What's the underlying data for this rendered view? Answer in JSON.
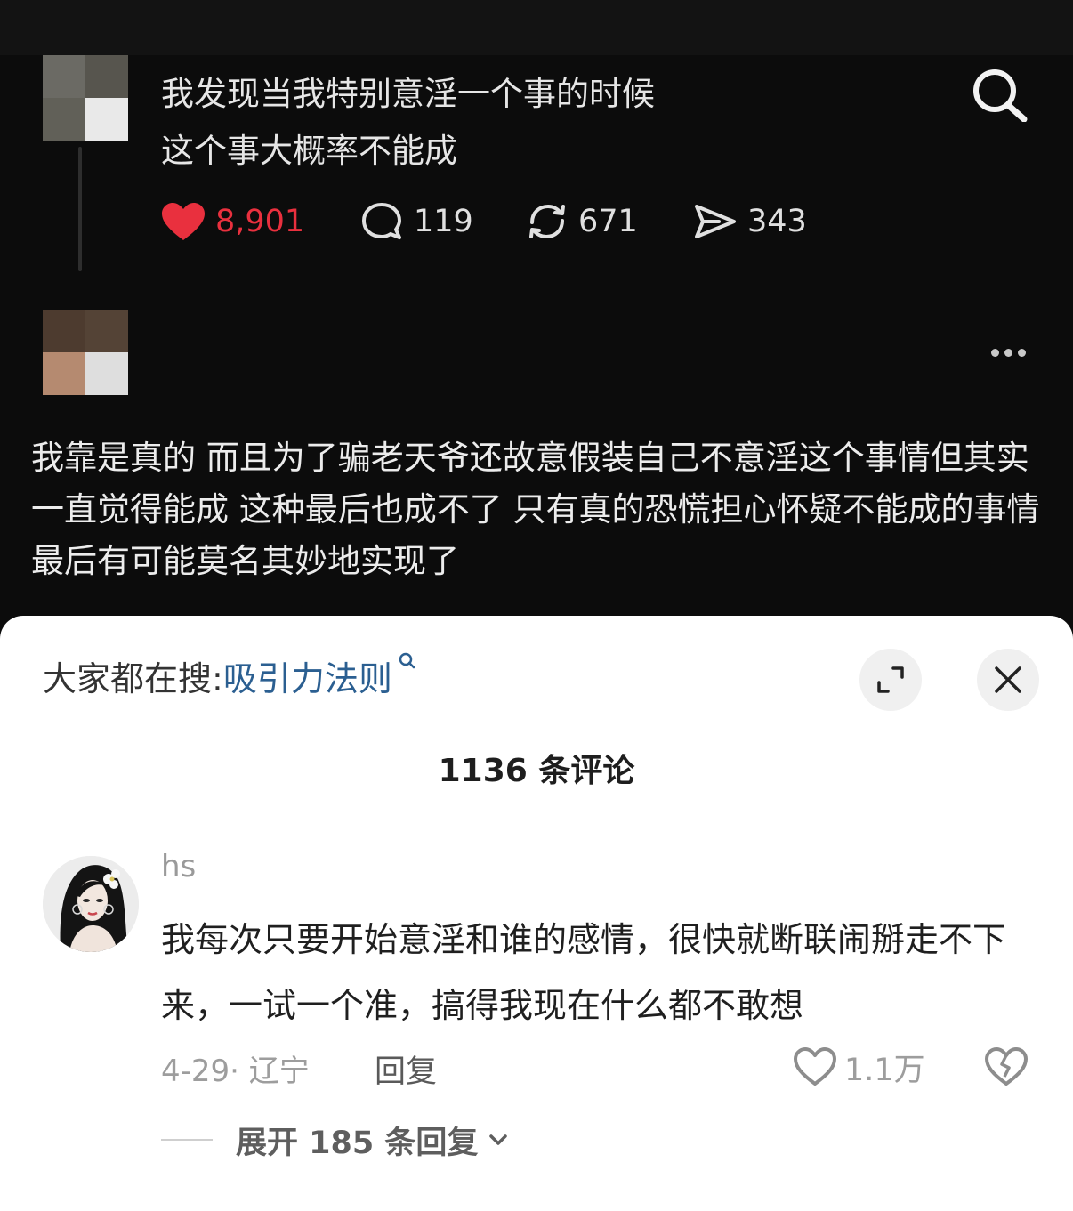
{
  "post": {
    "text_line1": "我发现当我特别意淫一个事的时候",
    "text_line2": "这个事大概率不能成",
    "likes": "8,901",
    "comments": "119",
    "reposts": "671",
    "shares": "343"
  },
  "reply_post": {
    "text": "我靠是真的 而且为了骗老天爷还故意假装自己不意淫这个事情但其实一直觉得能成 这种最后也成不了 只有真的恐慌担心怀疑不能成的事情最后有可能莫名其妙地实现了"
  },
  "comments_sheet": {
    "search_prefix": "大家都在搜:",
    "search_term": "吸引力法则",
    "title": "1136 条评论",
    "comment": {
      "username": "hs",
      "text": "我每次只要开始意淫和谁的感情，很快就断联闹掰走不下来，一试一个准，搞得我现在什么都不敢想",
      "meta": "4-29· 辽宁",
      "reply_label": "回复",
      "likes": "1.1万",
      "expand_label": "展开 185 条回复"
    }
  },
  "colors": {
    "like_red": "#e9303e",
    "link_blue": "#2b5f91"
  },
  "icons": [
    "search-icon",
    "heart-filled-icon",
    "comment-icon",
    "repost-icon",
    "share-icon",
    "more-icon",
    "expand-icon",
    "close-icon",
    "heart-outline-icon",
    "broken-heart-icon",
    "chevron-down-icon"
  ]
}
